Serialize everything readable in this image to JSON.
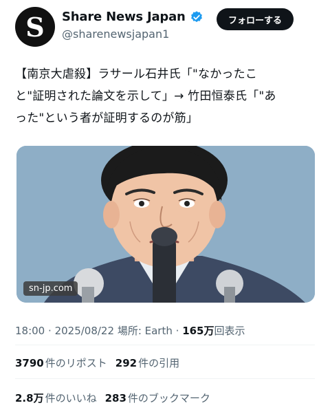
{
  "account": {
    "display_name": "Share News Japan",
    "handle": "@sharenewsjapan1",
    "avatar_letter": "S",
    "verified": true,
    "follow_label": "フォローする"
  },
  "tweet": {
    "line1": "【南京大虐殺】ラサール石井氏「\"なかったこ",
    "line2": "と\"証明された論文を示して」→ 竹田恒泰氏「\"あ",
    "line3": "った\"という者が証明するのが筋」"
  },
  "media": {
    "watermark": "sn-jp.com",
    "background_color": "#8eaec6"
  },
  "meta": {
    "time": "18:00",
    "date": "2025/08/22",
    "location_label": "場所: Earth",
    "views": "165万",
    "views_label": "回表示"
  },
  "stats": {
    "reposts": {
      "num": "3790",
      "label": "件のリポスト"
    },
    "quotes": {
      "num": "292",
      "label": "件の引用"
    },
    "likes": {
      "num": "2.8万",
      "label": "件のいいね"
    },
    "bookmarks": {
      "num": "283",
      "label": "件のブックマーク"
    }
  },
  "colors": {
    "text": "#0f1419",
    "secondary": "#536471",
    "verified": "#1d9bf0"
  }
}
